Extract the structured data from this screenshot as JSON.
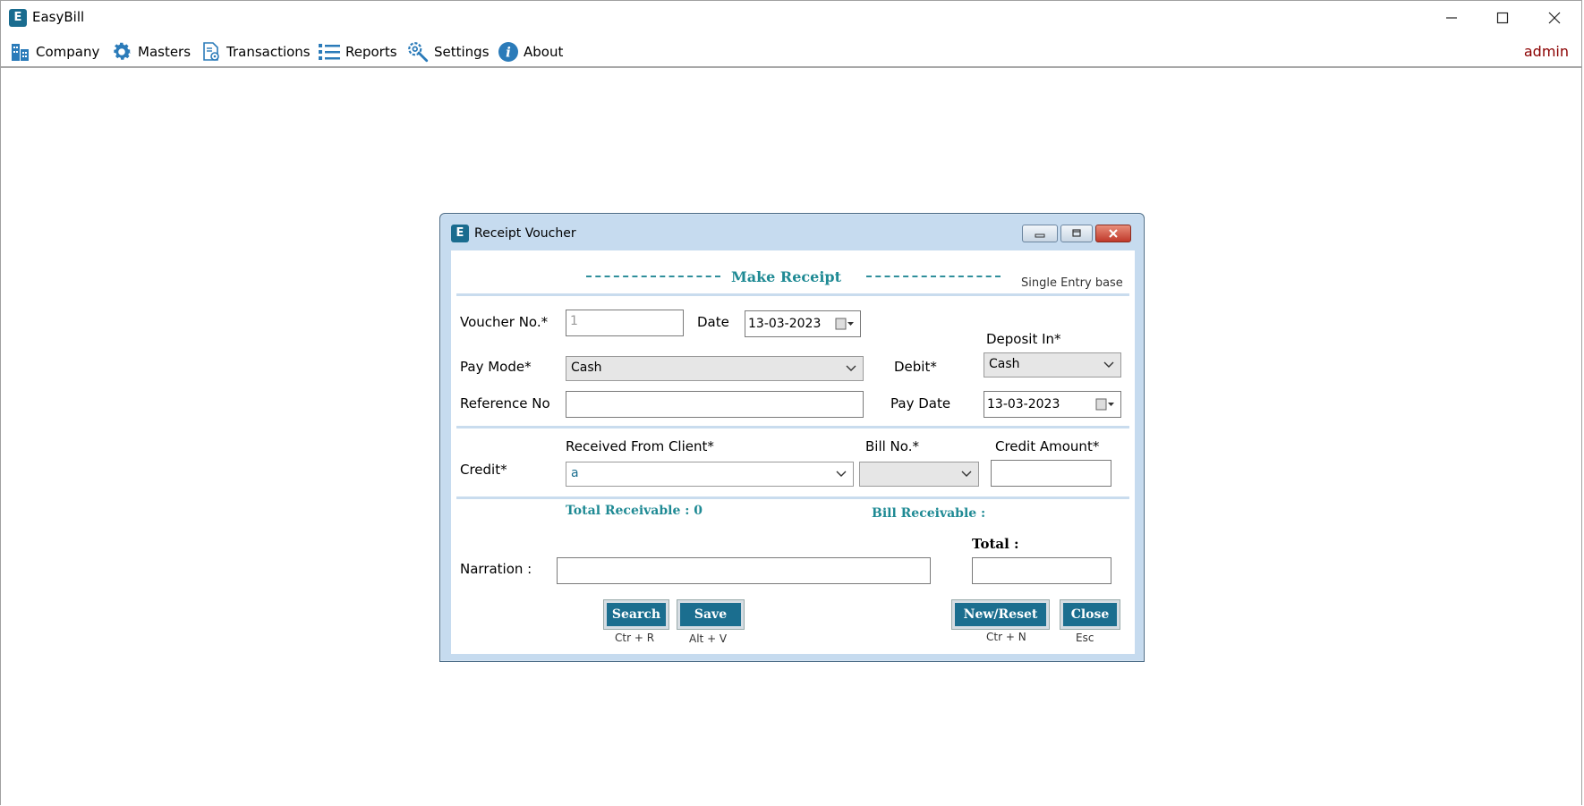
{
  "app": {
    "title": "EasyBill",
    "logo_letter": "E",
    "user": "admin",
    "window_controls": {
      "minimize": "—",
      "maximize": "☐",
      "close": "✕"
    }
  },
  "menu": [
    {
      "label": "Company",
      "icon": "building-icon"
    },
    {
      "label": "Masters",
      "icon": "gear-icon"
    },
    {
      "label": "Transactions",
      "icon": "document-gear-icon"
    },
    {
      "label": "Reports",
      "icon": "list-icon"
    },
    {
      "label": "Settings",
      "icon": "wrench-gear-icon"
    },
    {
      "label": "About",
      "icon": "info-icon"
    }
  ],
  "dialog": {
    "title": "Receipt Voucher",
    "logo_letter": "E",
    "heading": "Make Receipt",
    "subheading": "Single Entry base",
    "voucher_no_label": "Voucher No.*",
    "voucher_no_value": "1",
    "date_label": "Date",
    "date_value": "13-03-2023",
    "deposit_in_label": "Deposit In*",
    "deposit_in_value": "Cash",
    "pay_mode_label": "Pay Mode*",
    "pay_mode_value": "Cash",
    "debit_label": "Debit*",
    "reference_no_label": "Reference No",
    "reference_no_value": "",
    "pay_date_label": "Pay Date",
    "pay_date_value": "13-03-2023",
    "credit_label": "Credit*",
    "received_from_label": "Received From Client*",
    "received_from_value": "a",
    "bill_no_label": "Bill No.*",
    "bill_no_value": "",
    "credit_amount_label": "Credit Amount*",
    "credit_amount_value": "",
    "total_receivable": "Total Receivable : 0",
    "bill_receivable": "Bill Receivable :",
    "total_label": "Total :",
    "total_value": "",
    "narration_label": "Narration :",
    "narration_value": "",
    "buttons": {
      "search": "Search",
      "search_hint": "Ctr + R",
      "save": "Save",
      "save_hint": "Alt + V",
      "new_reset": "New/Reset",
      "new_reset_hint": "Ctr + N",
      "close": "Close",
      "close_hint": "Esc"
    },
    "accent_color": "#1b6e8f",
    "heading_color": "#1f8a94"
  }
}
